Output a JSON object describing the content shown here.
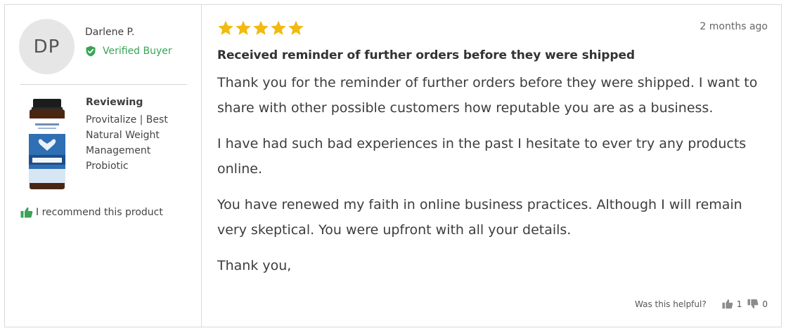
{
  "reviewer": {
    "initials": "DP",
    "name": "Darlene P.",
    "verified_label": "Verified Buyer"
  },
  "product": {
    "reviewing_label": "Reviewing",
    "name": "Provitalize | Best Natural Weight Management Probiotic",
    "image_icon": "product-bottle-icon"
  },
  "recommend_label": "I recommend this product",
  "review": {
    "rating": 5,
    "rating_max": 5,
    "date": "2 months ago",
    "title": "Received reminder of further orders before they were shipped",
    "paragraphs": [
      "Thank you for the reminder of further orders before they were shipped. I want to share with other possible customers how reputable you are as a business.",
      "I have had such bad experiences in the past I hesitate to ever try any products online.",
      "You have renewed my faith in online business practices. Although I will remain very skeptical. You were upfront with all your details.",
      "Thank you,"
    ]
  },
  "helpful": {
    "label": "Was this helpful?",
    "up_count": "1",
    "down_count": "0"
  },
  "colors": {
    "star": "#f2b90f",
    "verified": "#3aa356",
    "avatar_bg": "#e6e6e6"
  }
}
